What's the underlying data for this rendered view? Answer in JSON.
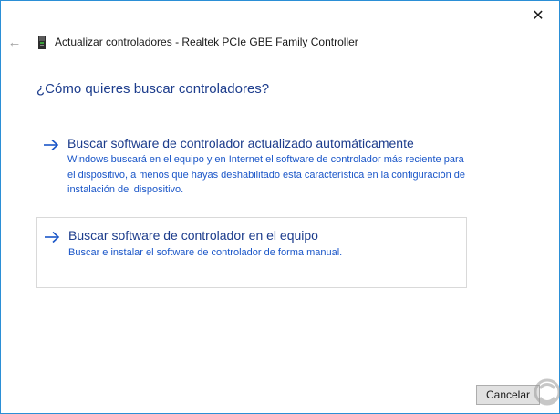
{
  "window": {
    "close_glyph": "✕",
    "back_glyph": "←",
    "title": "Actualizar controladores - Realtek PCIe GBE Family Controller",
    "icon": "network-device-icon"
  },
  "main": {
    "question": "¿Cómo quieres buscar controladores?",
    "options": [
      {
        "title": "Buscar software de controlador actualizado automáticamente",
        "description": "Windows buscará en el equipo y en Internet el software de controlador más reciente para el dispositivo, a menos que hayas deshabilitado esta característica en la configuración de instalación del dispositivo.",
        "icon": "arrow-right-icon"
      },
      {
        "title": "Buscar software de controlador en el equipo",
        "description": "Buscar e instalar el software de controlador de forma manual.",
        "icon": "arrow-right-icon"
      }
    ]
  },
  "footer": {
    "cancel_label": "Cancelar"
  },
  "colors": {
    "accent": "#1c3c8c",
    "link": "#1a56c8",
    "border": "#2b8fd6"
  }
}
